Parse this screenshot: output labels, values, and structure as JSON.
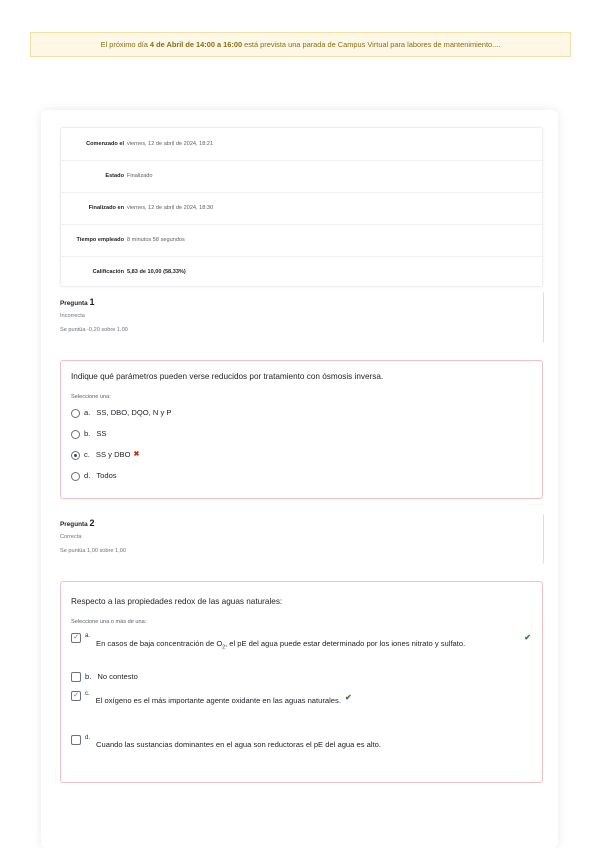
{
  "notice": {
    "prefix": "El próximo día ",
    "bold_date": "4 de Abril de 14:00 a 16:00",
    "suffix": " está prevista una parada de Campus Virtual para labores de mantenimiento...."
  },
  "summary": [
    {
      "label": "Comenzado el",
      "value": "viernes, 12 de abril de 2024, 18:21"
    },
    {
      "label": "Estado",
      "value": "Finalizado"
    },
    {
      "label": "Finalizado en",
      "value": "viernes, 12 de abril de 2024, 18:30"
    },
    {
      "label": "Tiempo empleado",
      "value": "8 minutos 58 segundos"
    },
    {
      "label": "Calificación",
      "value": "5,83 de 10,00 (58,33%)"
    }
  ],
  "q1": {
    "label": "Pregunta",
    "number": "1",
    "state": "Incorrecta",
    "grade": "Se puntúa -0,20 sobre 1,00",
    "text": "Indique qué parámetros pueden verse reducidos por tratamiento con ósmosis inversa.",
    "prompt": "Seleccione una:",
    "options": [
      {
        "letter": "a.",
        "text": "SS, DBO, DQO, N y P"
      },
      {
        "letter": "b.",
        "text": "SS"
      },
      {
        "letter": "c.",
        "text": "SS y DBO"
      },
      {
        "letter": "d.",
        "text": "Todos"
      }
    ]
  },
  "q2": {
    "label": "Pregunta",
    "number": "2",
    "state": "Correcta",
    "grade": "Se puntúa 1,00 sobre 1,00",
    "text": "Respecto a las propiedades redox de las aguas naturales:",
    "prompt": "Seleccione una o más de una:",
    "options": [
      {
        "letter": "a.",
        "text_pre": "En casos de baja concentración de O",
        "sub": "2",
        "text_post": ", el pE del agua puede estar determinado por los iones nitrato y sulfato."
      },
      {
        "letter": "b.",
        "text": "No contesto"
      },
      {
        "letter": "c.",
        "text": "El oxígeno es el más importante agente oxidante en las aguas naturales."
      },
      {
        "letter": "d.",
        "text": "Cuando las sustancias dominantes en el agua son reductoras el pE del agua es alto."
      }
    ]
  },
  "colors": {
    "incorrect": "#ca3120",
    "correct": "#357a32",
    "notice_bg": "#fdf8e6"
  },
  "icons": {
    "incorrect": "cross-icon",
    "correct": "check-icon"
  }
}
